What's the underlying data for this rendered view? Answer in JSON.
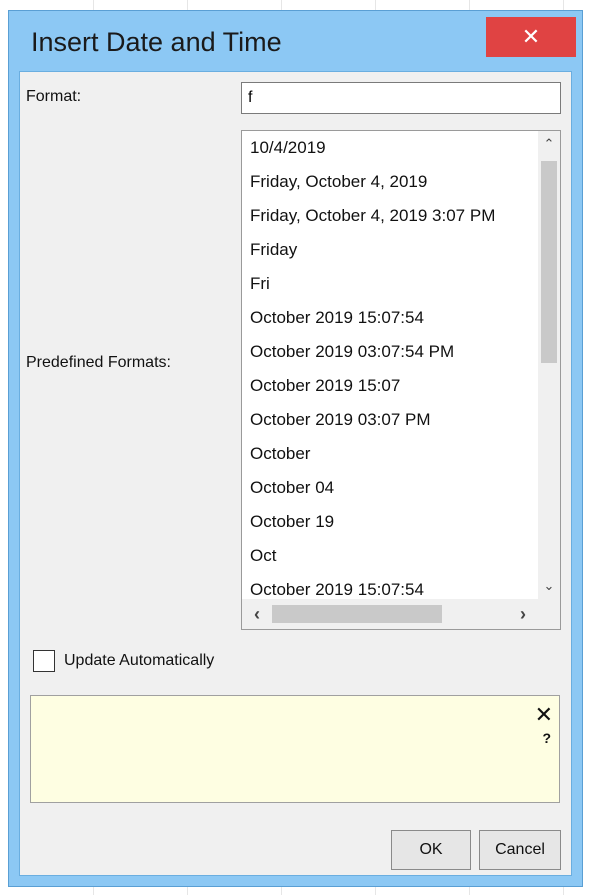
{
  "window": {
    "title": "Insert Date and Time",
    "close_glyph": "✕"
  },
  "form": {
    "format_label": "Format:",
    "format_value": "f",
    "predefined_label": "Predefined Formats:",
    "update_label": "Update Automatically",
    "update_checked": false
  },
  "predefined_formats": [
    "10/4/2019",
    "Friday, October 4, 2019",
    "Friday, October 4, 2019 3:07 PM",
    "Friday",
    "Fri",
    "October 2019 15:07:54",
    "October 2019 03:07:54 PM",
    "October 2019 15:07",
    "October 2019 03:07 PM",
    "October",
    "October 04",
    "October 19",
    "Oct",
    "October 2019 15:07:54"
  ],
  "scrollbars": {
    "up_glyph": "⌃",
    "down_glyph": "⌄",
    "left_glyph": "‹",
    "right_glyph": "›"
  },
  "help": {
    "close_glyph": "✕",
    "question_glyph": "?"
  },
  "buttons": {
    "ok": "OK",
    "cancel": "Cancel"
  }
}
